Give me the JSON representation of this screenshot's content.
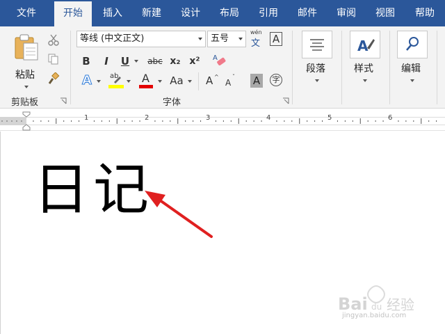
{
  "tabs": [
    "文件",
    "开始",
    "插入",
    "新建",
    "设计",
    "布局",
    "引用",
    "邮件",
    "审阅",
    "视图",
    "帮助"
  ],
  "active_tab_index": 1,
  "clipboard": {
    "paste_label": "粘贴",
    "group_label": "剪贴板"
  },
  "font": {
    "font_name": "等线 (中文正文)",
    "font_size": "五号",
    "group_label": "字体",
    "bold": "B",
    "italic": "I",
    "underline": "U",
    "strike": "abc",
    "subscript": "x₂",
    "superscript": "x²",
    "phonetic_top": "wén",
    "phonetic_bottom": "文",
    "char_border": "A",
    "text_effect": "A",
    "highlight": "ab",
    "font_color": "A",
    "change_case": "Aa",
    "grow": "A",
    "shrink": "A",
    "shading": "A",
    "enclose": "字",
    "highlight_color": "#ffff00",
    "font_color_swatch": "#e30000"
  },
  "paragraph": {
    "label": "段落"
  },
  "styles": {
    "label": "样式"
  },
  "editing": {
    "label": "编辑"
  },
  "ruler": {
    "numbers": [
      "1",
      "2",
      "3",
      "4",
      "5",
      "6"
    ]
  },
  "document": {
    "text": "日记"
  },
  "watermark": {
    "brand": "Bai",
    "brand2": "经验",
    "url": "jingyan.baidu.com"
  },
  "colors": {
    "ribbon_blue": "#2b579a",
    "arrow_red": "#e02020"
  }
}
